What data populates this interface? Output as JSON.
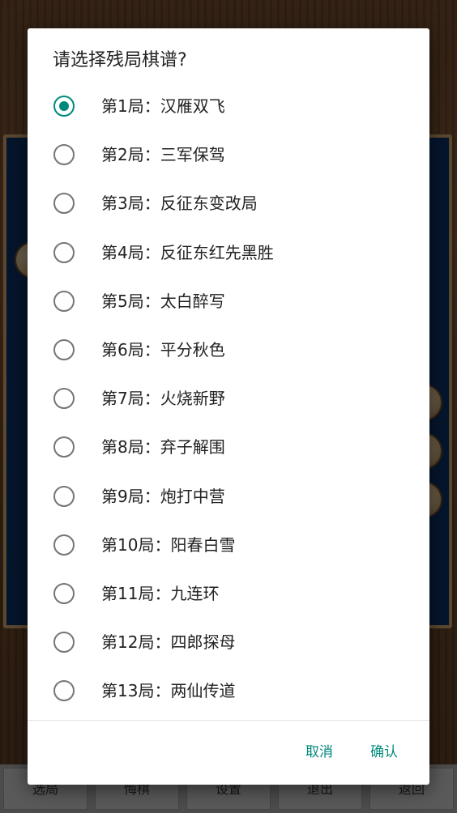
{
  "background": {
    "toolbar": [
      "选局",
      "悔棋",
      "设置",
      "退出",
      "返回"
    ]
  },
  "dialog": {
    "title": "请选择残局棋谱?",
    "options": [
      {
        "label": "第1局：汉雁双飞",
        "selected": true
      },
      {
        "label": "第2局：三军保驾",
        "selected": false
      },
      {
        "label": "第3局：反征东变改局",
        "selected": false
      },
      {
        "label": "第4局：反征东红先黑胜",
        "selected": false
      },
      {
        "label": "第5局：太白醉写",
        "selected": false
      },
      {
        "label": "第6局：平分秋色",
        "selected": false
      },
      {
        "label": "第7局：火烧新野",
        "selected": false
      },
      {
        "label": "第8局：弃子解围",
        "selected": false
      },
      {
        "label": "第9局：炮打中营",
        "selected": false
      },
      {
        "label": "第10局：阳春白雪",
        "selected": false
      },
      {
        "label": "第11局：九连环",
        "selected": false
      },
      {
        "label": "第12局：四郎探母",
        "selected": false
      },
      {
        "label": "第13局：两仙传道",
        "selected": false
      }
    ],
    "cancel_label": "取消",
    "confirm_label": "确认"
  },
  "colors": {
    "accent": "#00897b",
    "board": "#0c2f63",
    "scrim": "rgba(0,0,0,0.55)"
  }
}
